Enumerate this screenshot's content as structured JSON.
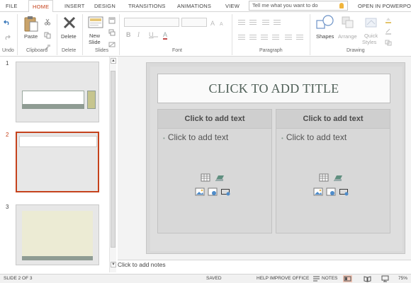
{
  "tabs": [
    "FILE",
    "HOME",
    "INSERT",
    "DESIGN",
    "TRANSITIONS",
    "ANIMATIONS",
    "VIEW"
  ],
  "active_tab": "HOME",
  "tell_me": {
    "placeholder": "Tell me what you want to do"
  },
  "open_in": "OPEN IN POWERPOINT",
  "ribbon": {
    "groups": [
      "Undo",
      "Clipboard",
      "Delete",
      "Slides",
      "Font",
      "Paragraph",
      "Drawing"
    ],
    "paste_label": "Paste",
    "delete_label": "Delete",
    "new_slide_line1": "New",
    "new_slide_line2": "Slide",
    "shapes_label": "Shapes",
    "arrange_label": "Arrange",
    "quick_styles_line1": "Quick",
    "quick_styles_line2": "Styles",
    "font_buttons": [
      "B",
      "I",
      "U",
      "A"
    ]
  },
  "thumbnails": [
    {
      "number": "1",
      "selected": false
    },
    {
      "number": "2",
      "selected": true
    },
    {
      "number": "3",
      "selected": false
    }
  ],
  "slide": {
    "title": "CLICK TO ADD TITLE",
    "left_heading": "Click to add text",
    "left_bullet": "Click to add text",
    "right_heading": "Click to add text",
    "right_bullet": "Click to add text"
  },
  "notes": "Click to add notes",
  "status": {
    "slide_info": "SLIDE 2 OF 3",
    "saved": "SAVED",
    "help": "HELP IMPROVE OFFICE",
    "notes_btn": "NOTES",
    "zoom": "75%"
  },
  "colors": {
    "accent": "#c5421c",
    "title_text": "#4f5f57",
    "slide_bg": "#dedede"
  }
}
